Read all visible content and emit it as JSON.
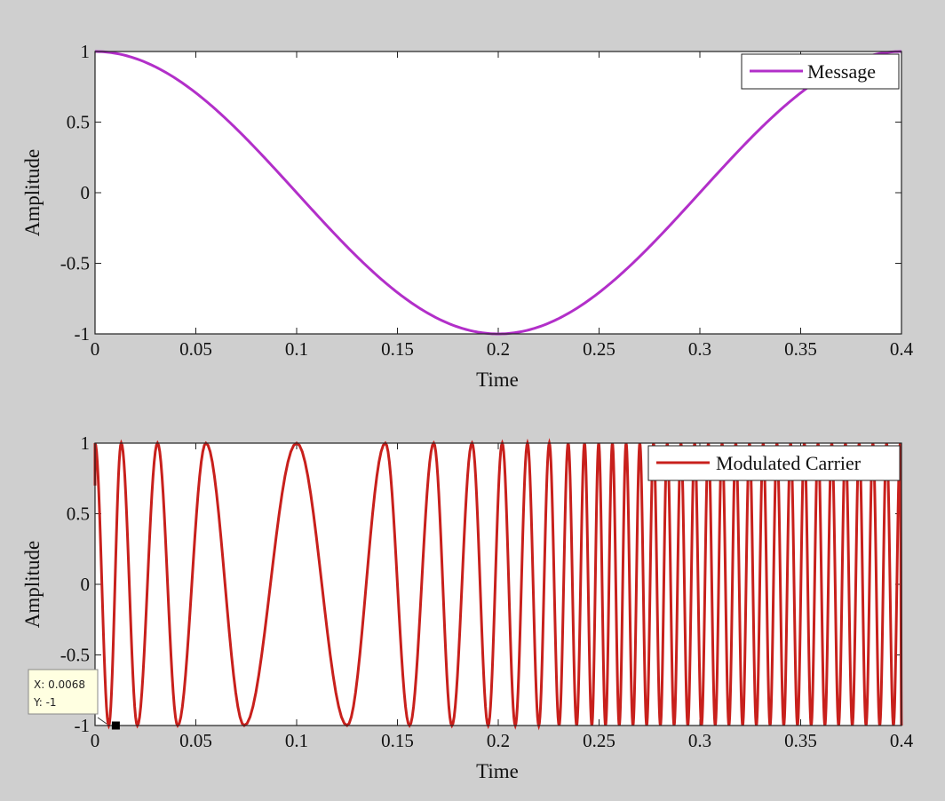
{
  "chart_data": [
    {
      "type": "line",
      "xlabel": "Time",
      "ylabel": "Amplitude",
      "xlim": [
        0,
        0.4
      ],
      "ylim": [
        -1,
        1
      ],
      "xticks": [
        "0",
        "0.05",
        "0.1",
        "0.15",
        "0.2",
        "0.25",
        "0.3",
        "0.35",
        "0.4"
      ],
      "yticks": [
        "-1",
        "-0.5",
        "0",
        "0.5",
        "1"
      ],
      "grid": false,
      "legend": {
        "placement": "top-right",
        "entries": [
          "Message"
        ]
      },
      "series": [
        {
          "name": "Message",
          "color": "#b22fc9",
          "x": [
            0,
            0.025,
            0.05,
            0.075,
            0.1,
            0.125,
            0.15,
            0.175,
            0.2,
            0.225,
            0.25,
            0.275,
            0.3,
            0.325,
            0.35,
            0.375,
            0.4
          ],
          "y": [
            1,
            0.92,
            0.71,
            0.38,
            0,
            -0.38,
            -0.71,
            -0.92,
            -1,
            -0.92,
            -0.71,
            -0.38,
            0,
            0.38,
            0.71,
            0.92,
            1
          ]
        }
      ]
    },
    {
      "type": "line",
      "xlabel": "Time",
      "ylabel": "Amplitude",
      "xlim": [
        0,
        0.4
      ],
      "ylim": [
        -1,
        1
      ],
      "xticks": [
        "0",
        "0.05",
        "0.1",
        "0.15",
        "0.2",
        "0.25",
        "0.3",
        "0.35",
        "0.4"
      ],
      "yticks": [
        "-1",
        "-0.5",
        "0",
        "0.5",
        "1"
      ],
      "grid": false,
      "legend": {
        "placement": "top-right",
        "entries": [
          "Modulated Carrier"
        ]
      },
      "series": [
        {
          "name": "Modulated Carrier",
          "color": "#c8201c",
          "peaks_x": [
            0,
            0.013,
            0.031,
            0.055,
            0.1,
            0.144,
            0.168,
            0.187
          ],
          "troughs_x": [
            0.0068,
            0.021,
            0.041,
            0.074,
            0.125,
            0.156,
            0.177,
            0.195
          ],
          "y_range": [
            -1,
            1
          ]
        }
      ],
      "datatip": {
        "x_label": "X: 0.0068",
        "y_label": "Y: -1",
        "x": 0.0068,
        "y": -1
      }
    }
  ]
}
